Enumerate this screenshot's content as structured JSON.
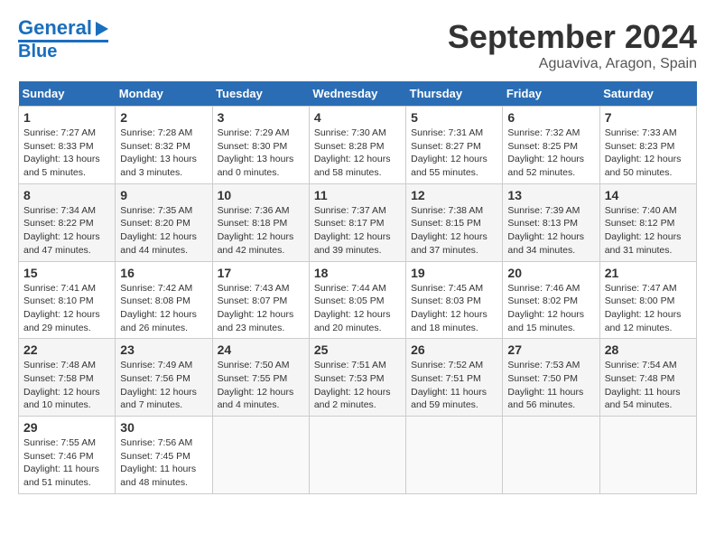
{
  "header": {
    "logo_line1": "General",
    "logo_line2": "Blue",
    "month": "September 2024",
    "location": "Aguaviva, Aragon, Spain"
  },
  "days_of_week": [
    "Sunday",
    "Monday",
    "Tuesday",
    "Wednesday",
    "Thursday",
    "Friday",
    "Saturday"
  ],
  "weeks": [
    [
      {
        "day": "1",
        "sunrise": "Sunrise: 7:27 AM",
        "sunset": "Sunset: 8:33 PM",
        "daylight": "Daylight: 13 hours and 5 minutes."
      },
      {
        "day": "2",
        "sunrise": "Sunrise: 7:28 AM",
        "sunset": "Sunset: 8:32 PM",
        "daylight": "Daylight: 13 hours and 3 minutes."
      },
      {
        "day": "3",
        "sunrise": "Sunrise: 7:29 AM",
        "sunset": "Sunset: 8:30 PM",
        "daylight": "Daylight: 13 hours and 0 minutes."
      },
      {
        "day": "4",
        "sunrise": "Sunrise: 7:30 AM",
        "sunset": "Sunset: 8:28 PM",
        "daylight": "Daylight: 12 hours and 58 minutes."
      },
      {
        "day": "5",
        "sunrise": "Sunrise: 7:31 AM",
        "sunset": "Sunset: 8:27 PM",
        "daylight": "Daylight: 12 hours and 55 minutes."
      },
      {
        "day": "6",
        "sunrise": "Sunrise: 7:32 AM",
        "sunset": "Sunset: 8:25 PM",
        "daylight": "Daylight: 12 hours and 52 minutes."
      },
      {
        "day": "7",
        "sunrise": "Sunrise: 7:33 AM",
        "sunset": "Sunset: 8:23 PM",
        "daylight": "Daylight: 12 hours and 50 minutes."
      }
    ],
    [
      {
        "day": "8",
        "sunrise": "Sunrise: 7:34 AM",
        "sunset": "Sunset: 8:22 PM",
        "daylight": "Daylight: 12 hours and 47 minutes."
      },
      {
        "day": "9",
        "sunrise": "Sunrise: 7:35 AM",
        "sunset": "Sunset: 8:20 PM",
        "daylight": "Daylight: 12 hours and 44 minutes."
      },
      {
        "day": "10",
        "sunrise": "Sunrise: 7:36 AM",
        "sunset": "Sunset: 8:18 PM",
        "daylight": "Daylight: 12 hours and 42 minutes."
      },
      {
        "day": "11",
        "sunrise": "Sunrise: 7:37 AM",
        "sunset": "Sunset: 8:17 PM",
        "daylight": "Daylight: 12 hours and 39 minutes."
      },
      {
        "day": "12",
        "sunrise": "Sunrise: 7:38 AM",
        "sunset": "Sunset: 8:15 PM",
        "daylight": "Daylight: 12 hours and 37 minutes."
      },
      {
        "day": "13",
        "sunrise": "Sunrise: 7:39 AM",
        "sunset": "Sunset: 8:13 PM",
        "daylight": "Daylight: 12 hours and 34 minutes."
      },
      {
        "day": "14",
        "sunrise": "Sunrise: 7:40 AM",
        "sunset": "Sunset: 8:12 PM",
        "daylight": "Daylight: 12 hours and 31 minutes."
      }
    ],
    [
      {
        "day": "15",
        "sunrise": "Sunrise: 7:41 AM",
        "sunset": "Sunset: 8:10 PM",
        "daylight": "Daylight: 12 hours and 29 minutes."
      },
      {
        "day": "16",
        "sunrise": "Sunrise: 7:42 AM",
        "sunset": "Sunset: 8:08 PM",
        "daylight": "Daylight: 12 hours and 26 minutes."
      },
      {
        "day": "17",
        "sunrise": "Sunrise: 7:43 AM",
        "sunset": "Sunset: 8:07 PM",
        "daylight": "Daylight: 12 hours and 23 minutes."
      },
      {
        "day": "18",
        "sunrise": "Sunrise: 7:44 AM",
        "sunset": "Sunset: 8:05 PM",
        "daylight": "Daylight: 12 hours and 20 minutes."
      },
      {
        "day": "19",
        "sunrise": "Sunrise: 7:45 AM",
        "sunset": "Sunset: 8:03 PM",
        "daylight": "Daylight: 12 hours and 18 minutes."
      },
      {
        "day": "20",
        "sunrise": "Sunrise: 7:46 AM",
        "sunset": "Sunset: 8:02 PM",
        "daylight": "Daylight: 12 hours and 15 minutes."
      },
      {
        "day": "21",
        "sunrise": "Sunrise: 7:47 AM",
        "sunset": "Sunset: 8:00 PM",
        "daylight": "Daylight: 12 hours and 12 minutes."
      }
    ],
    [
      {
        "day": "22",
        "sunrise": "Sunrise: 7:48 AM",
        "sunset": "Sunset: 7:58 PM",
        "daylight": "Daylight: 12 hours and 10 minutes."
      },
      {
        "day": "23",
        "sunrise": "Sunrise: 7:49 AM",
        "sunset": "Sunset: 7:56 PM",
        "daylight": "Daylight: 12 hours and 7 minutes."
      },
      {
        "day": "24",
        "sunrise": "Sunrise: 7:50 AM",
        "sunset": "Sunset: 7:55 PM",
        "daylight": "Daylight: 12 hours and 4 minutes."
      },
      {
        "day": "25",
        "sunrise": "Sunrise: 7:51 AM",
        "sunset": "Sunset: 7:53 PM",
        "daylight": "Daylight: 12 hours and 2 minutes."
      },
      {
        "day": "26",
        "sunrise": "Sunrise: 7:52 AM",
        "sunset": "Sunset: 7:51 PM",
        "daylight": "Daylight: 11 hours and 59 minutes."
      },
      {
        "day": "27",
        "sunrise": "Sunrise: 7:53 AM",
        "sunset": "Sunset: 7:50 PM",
        "daylight": "Daylight: 11 hours and 56 minutes."
      },
      {
        "day": "28",
        "sunrise": "Sunrise: 7:54 AM",
        "sunset": "Sunset: 7:48 PM",
        "daylight": "Daylight: 11 hours and 54 minutes."
      }
    ],
    [
      {
        "day": "29",
        "sunrise": "Sunrise: 7:55 AM",
        "sunset": "Sunset: 7:46 PM",
        "daylight": "Daylight: 11 hours and 51 minutes."
      },
      {
        "day": "30",
        "sunrise": "Sunrise: 7:56 AM",
        "sunset": "Sunset: 7:45 PM",
        "daylight": "Daylight: 11 hours and 48 minutes."
      },
      null,
      null,
      null,
      null,
      null
    ]
  ]
}
